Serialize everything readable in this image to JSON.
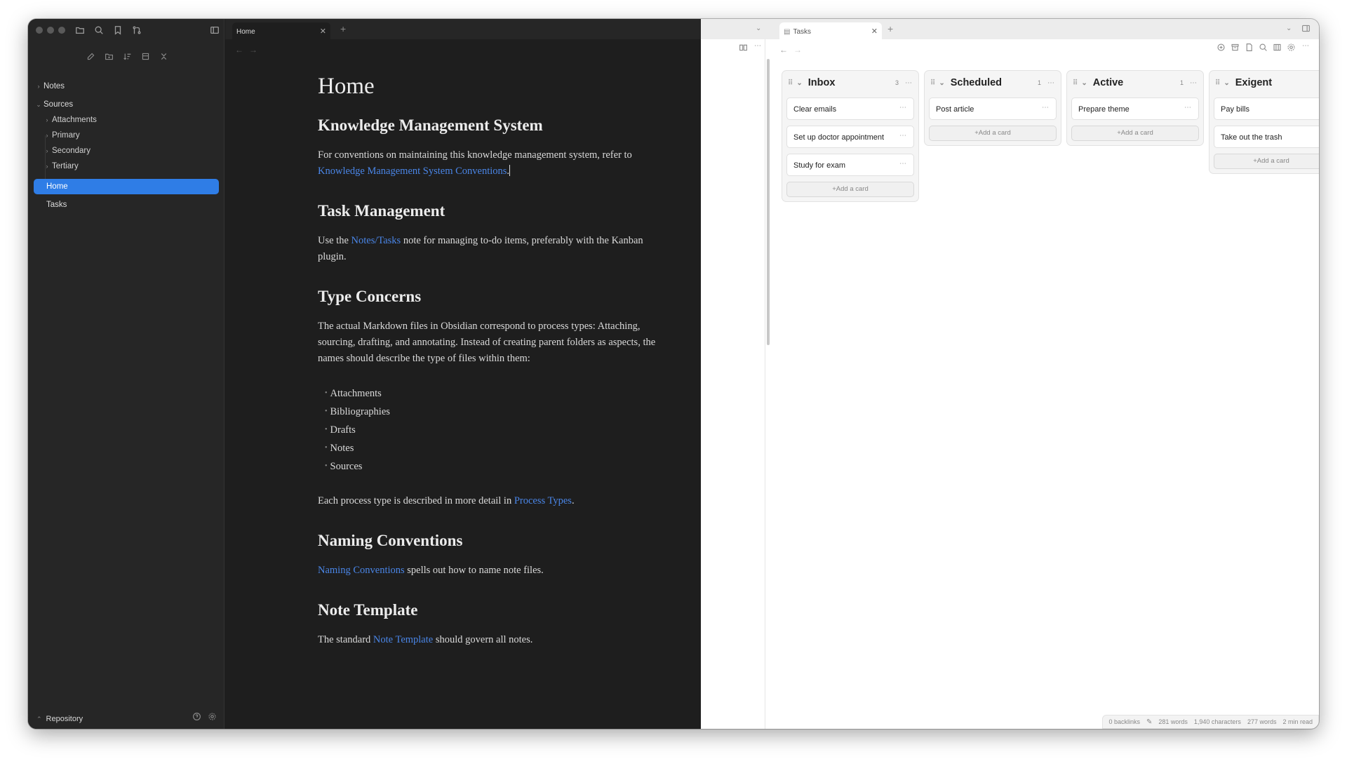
{
  "sidebar": {
    "tree": [
      {
        "label": "Notes",
        "level": 0,
        "expanded": false
      },
      {
        "label": "Sources",
        "level": 0,
        "expanded": true
      },
      {
        "label": "Attachments",
        "level": 1,
        "expanded": false
      },
      {
        "label": "Primary",
        "level": 1,
        "expanded": false
      },
      {
        "label": "Secondary",
        "level": 1,
        "expanded": false
      },
      {
        "label": "Tertiary",
        "level": 1,
        "expanded": false
      },
      {
        "label": "Home",
        "level": 0,
        "selected": true
      },
      {
        "label": "Tasks",
        "level": 0
      }
    ],
    "vault_name": "Repository"
  },
  "editor": {
    "tab_label": "Home",
    "doc": {
      "title": "Home",
      "h_kms": "Knowledge Management System",
      "p_kms": "For conventions on maintaining this knowledge management system, refer to ",
      "link_kms": "Knowledge Management System Conventions",
      "p_kms_end": ".",
      "h_tasks": "Task Management",
      "p_tasks_a": "Use the ",
      "link_tasks": "Notes/Tasks",
      "p_tasks_b": " note for managing to-do items, preferably with the Kanban plugin.",
      "h_types": "Type Concerns",
      "p_types": "The actual Markdown files in Obsidian correspond to process types: Attaching, sourcing, drafting, and annotating. Instead of creating parent folders as aspects, the names should describe the type of files within them:",
      "type_list": [
        "Attachments",
        "Bibliographies",
        "Drafts",
        "Notes",
        "Sources"
      ],
      "p_process_a": "Each process type is described in more detail in ",
      "link_process": "Process Types",
      "p_process_b": ".",
      "h_naming": "Naming Conventions",
      "link_naming": "Naming Conventions",
      "p_naming": " spells out how to name note files.",
      "h_template": "Note Template",
      "p_template_a": "The standard ",
      "link_template": "Note Template",
      "p_template_b": " should govern all notes."
    }
  },
  "kanban": {
    "tab_label": "Tasks",
    "lanes": [
      {
        "title": "Inbox",
        "count": "3",
        "cards": [
          "Clear emails",
          "Set up doctor appointment",
          "Study for exam"
        ]
      },
      {
        "title": "Scheduled",
        "count": "1",
        "cards": [
          "Post article"
        ]
      },
      {
        "title": "Active",
        "count": "1",
        "cards": [
          "Prepare theme"
        ]
      },
      {
        "title": "Exigent",
        "count": "",
        "cards": [
          "Pay bills",
          "Take out the trash"
        ]
      }
    ],
    "add_card_label": "+Add a card"
  },
  "status": {
    "backlinks": "0 backlinks",
    "words": "281 words",
    "characters": "1,940 characters",
    "words2": "277 words",
    "read": "2 min read"
  },
  "colors": {
    "accent": "#2f7de6",
    "link": "#4a86e8"
  }
}
